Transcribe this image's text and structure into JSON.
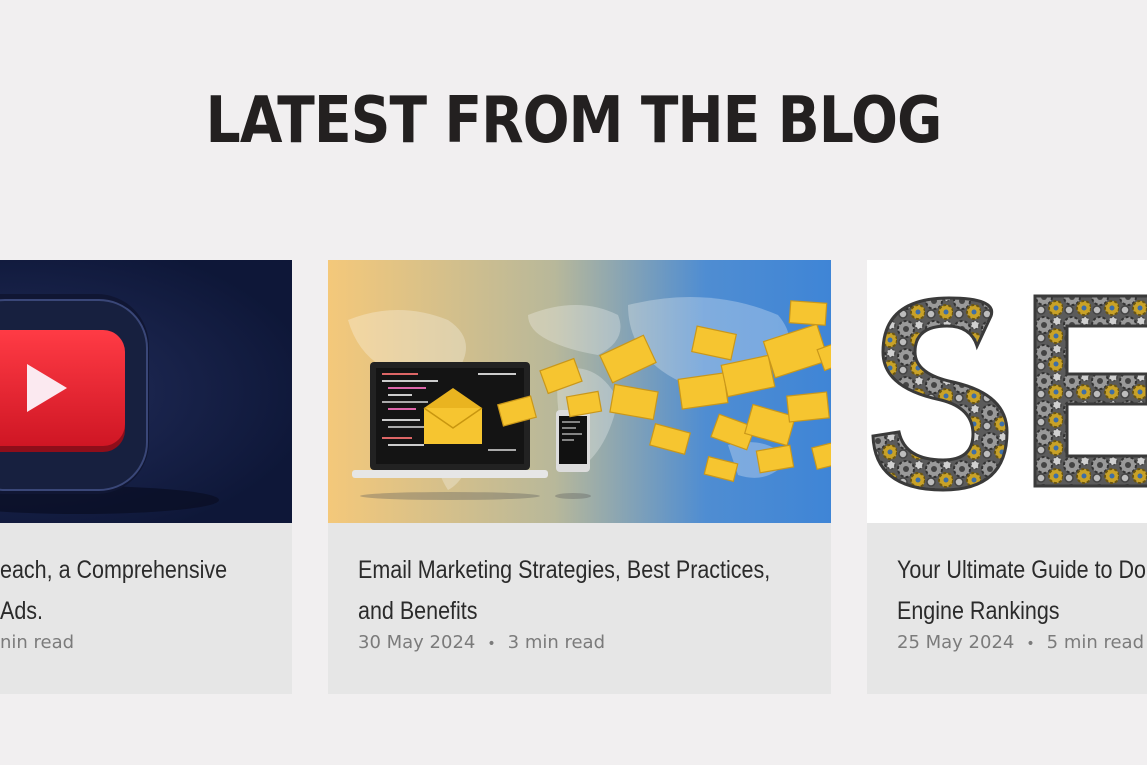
{
  "section": {
    "title": "LATEST FROM THE BLOG"
  },
  "posts": [
    {
      "title_line1": "each, a Comprehensive",
      "title_line2": "Ads.",
      "meta_date": "",
      "meta_read": "nin read",
      "image_icon": "youtube-logo-icon"
    },
    {
      "title_line1": "Email Marketing Strategies, Best Practices,",
      "title_line2": "and Benefits",
      "meta_date": "30 May 2024",
      "meta_read": "3 min read",
      "image_icon": "email-marketing-illustration"
    },
    {
      "title_line1": "Your Ultimate Guide to Do",
      "title_line2": "Engine Rankings",
      "meta_date": "25 May 2024",
      "meta_read": "5 min read",
      "image_icon": "seo-gears-illustration"
    }
  ],
  "colors": {
    "background": "#f1eff0",
    "card": "#e6e6e6",
    "title": "#232020",
    "meta": "#7b7b7b",
    "youtube_red": "#e8252f",
    "envelope_yellow": "#f6c530"
  }
}
